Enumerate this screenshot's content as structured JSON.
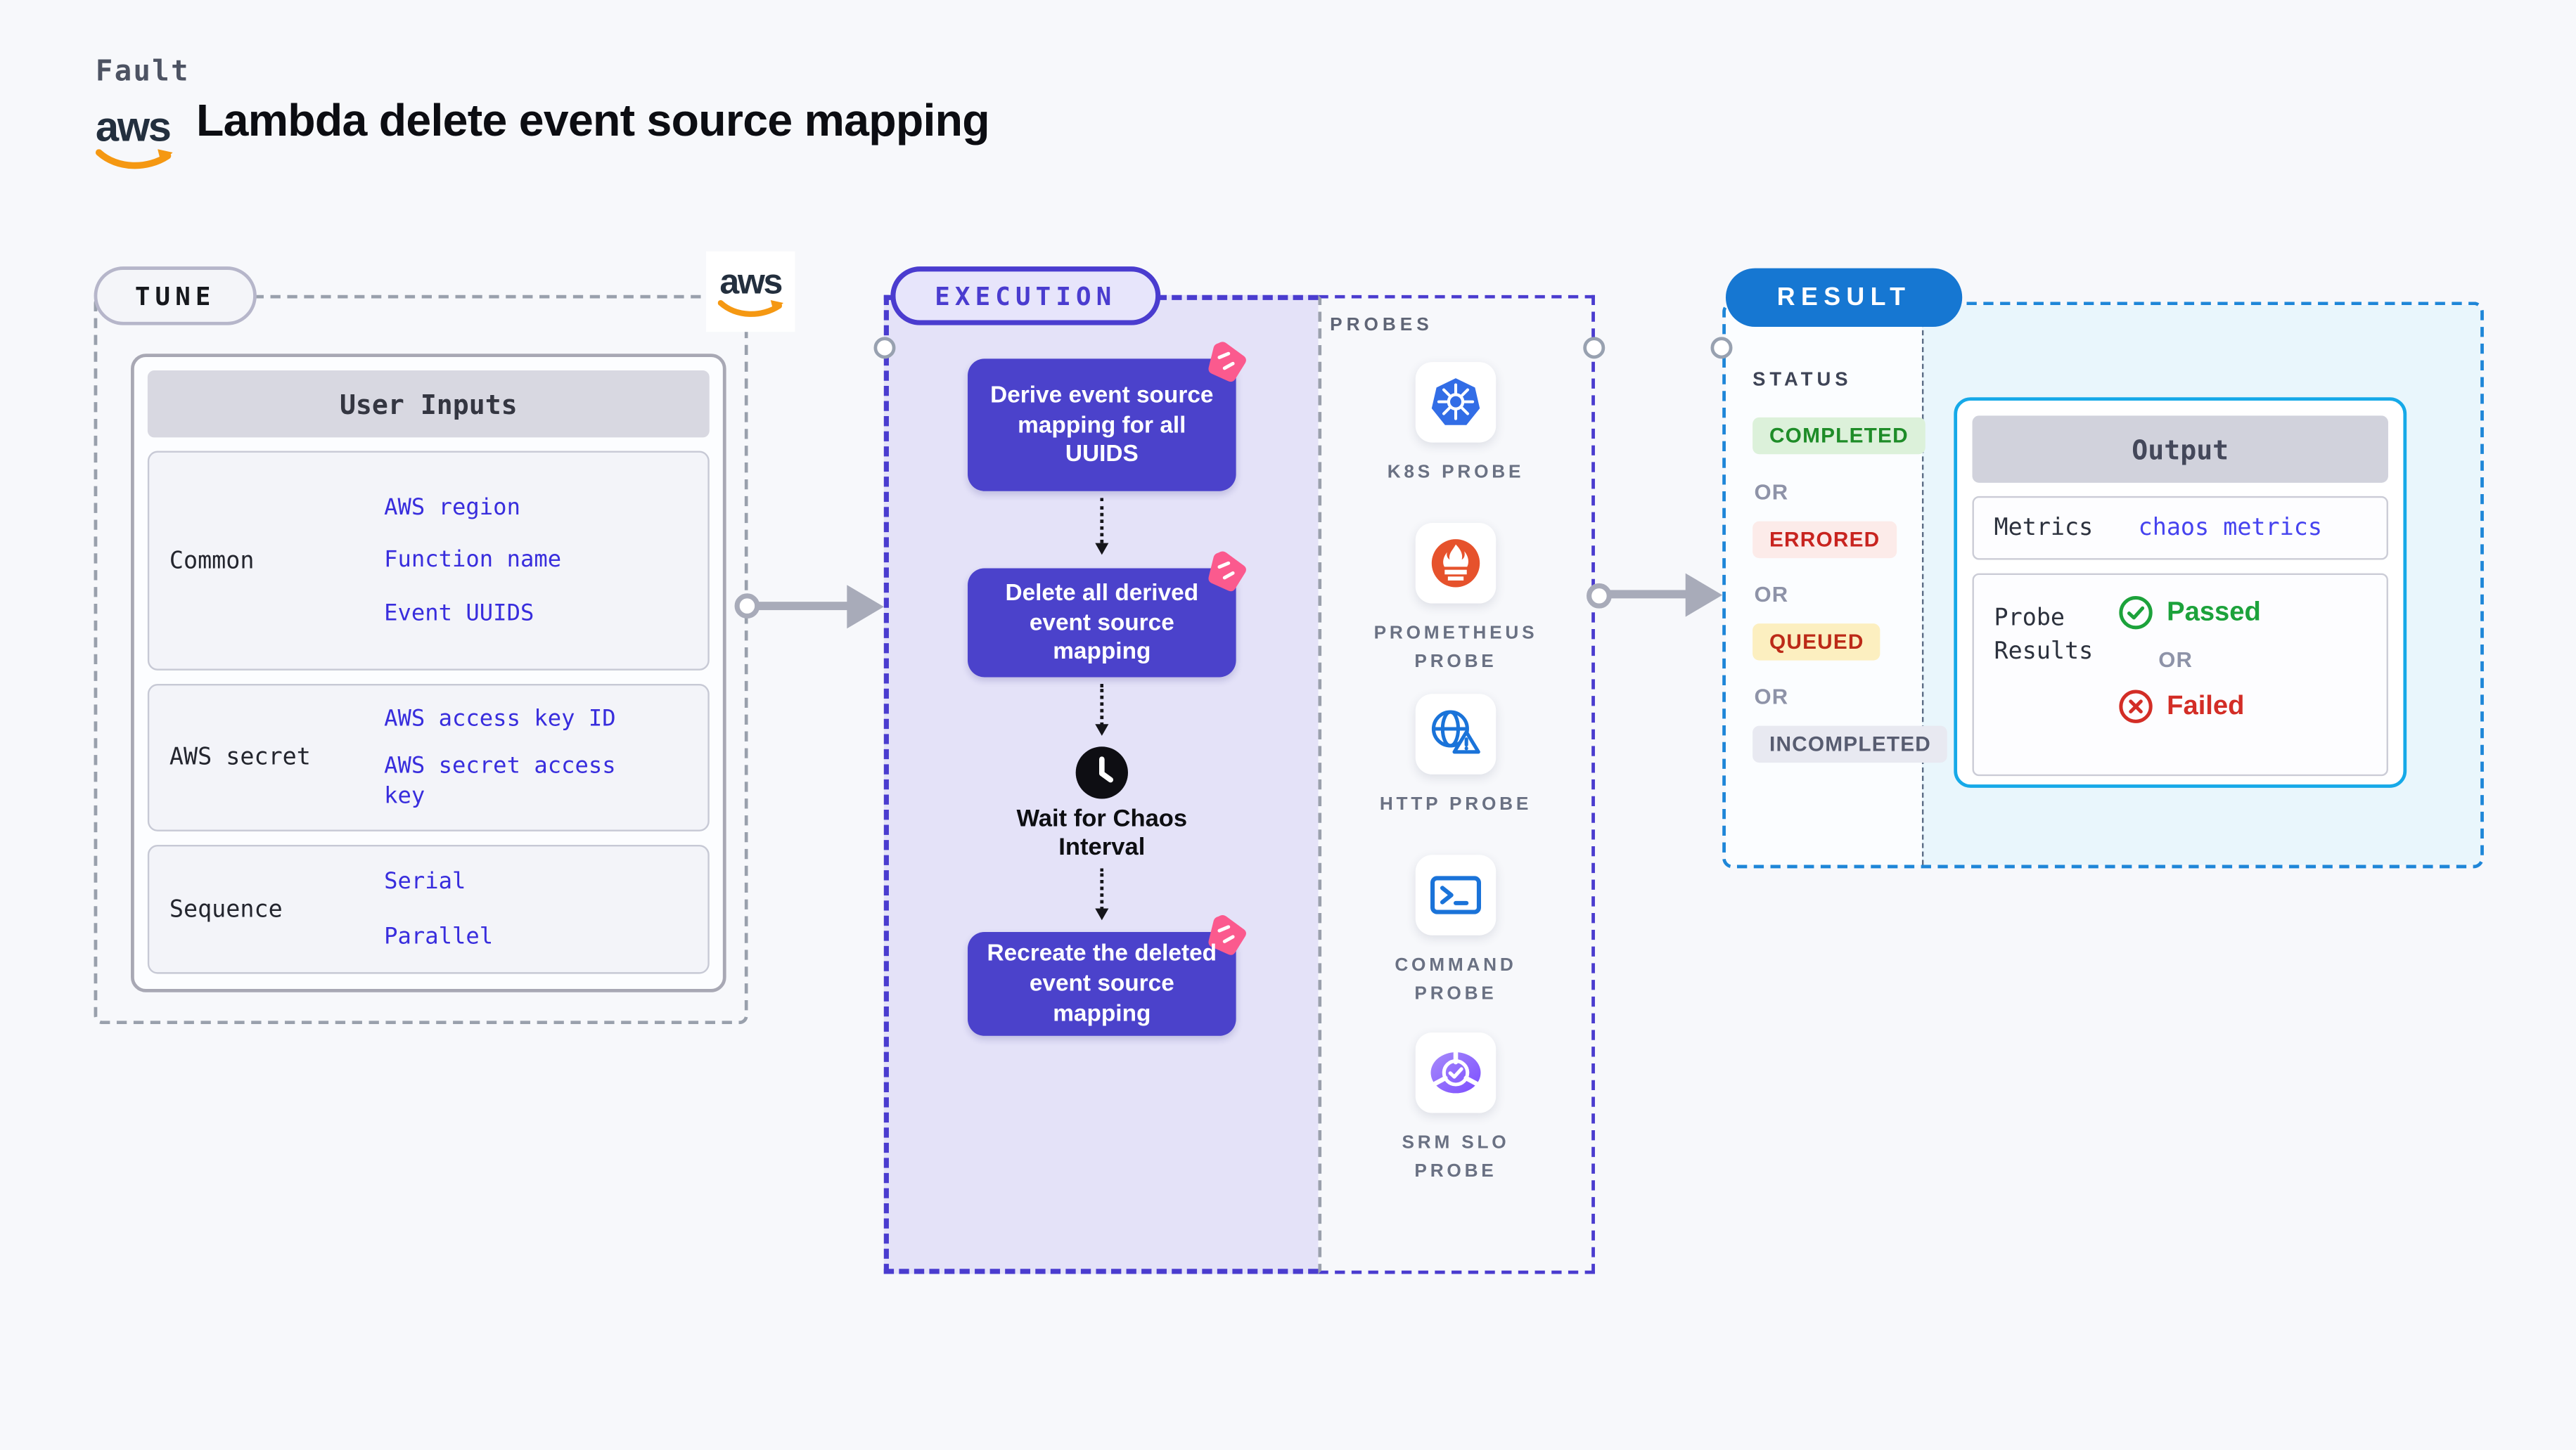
{
  "page": {
    "background": "#f7f8fb"
  },
  "header": {
    "kicker": "Fault",
    "title": "Lambda delete event source mapping",
    "aws_wordmark": "aws"
  },
  "tune": {
    "pill_label": "TUNE",
    "aws_wordmark": "aws",
    "user_inputs": {
      "header": "User Inputs",
      "rows": [
        {
          "label": "Common",
          "values": [
            "AWS region",
            "Function name",
            "Event UUIDS"
          ]
        },
        {
          "label": "AWS secret",
          "values": [
            "AWS access key ID",
            "AWS secret access key"
          ]
        },
        {
          "label": "Sequence",
          "values": [
            "Serial",
            "Parallel"
          ]
        }
      ]
    }
  },
  "execution": {
    "pill_label": "EXECUTION",
    "nodes": [
      {
        "label": "Derive event source mapping for all UUIDS",
        "icon": "chaos-step-icon"
      },
      {
        "label": "Delete all derived event source mapping",
        "icon": "chaos-step-icon"
      },
      {
        "label": "Recreate the deleted event source mapping",
        "icon": "chaos-step-icon"
      }
    ],
    "wait_step": {
      "label": "Wait for Chaos Interval",
      "icon": "clock-icon"
    }
  },
  "probes": {
    "heading": "PROBES",
    "items": [
      {
        "label": "K8S PROBE",
        "icon": "kubernetes-icon"
      },
      {
        "label": "PROMETHEUS PROBE",
        "icon": "prometheus-icon"
      },
      {
        "label": "HTTP PROBE",
        "icon": "http-globe-warning-icon"
      },
      {
        "label": "COMMAND PROBE",
        "icon": "terminal-icon"
      },
      {
        "label": "SRM SLO PROBE",
        "icon": "slo-donut-check-icon"
      }
    ]
  },
  "result": {
    "pill_label": "RESULT",
    "status": {
      "heading": "STATUS",
      "or_label": "OR",
      "badges": [
        {
          "label": "COMPLETED",
          "bg": "#dcf1da",
          "color": "#1e8c28"
        },
        {
          "label": "ERRORED",
          "bg": "#fcebe9",
          "color": "#c8241f"
        },
        {
          "label": "QUEUED",
          "bg": "#fcefc0",
          "color": "#bc2a18"
        },
        {
          "label": "INCOMPLETED",
          "bg": "#e8e9f1",
          "color": "#575c70"
        }
      ]
    },
    "output": {
      "header": "Output",
      "metrics_label": "Metrics",
      "metrics_link": "chaos metrics",
      "probe_results_label": "Probe Results",
      "passed_label": "Passed",
      "or_label": "OR",
      "failed_label": "Failed"
    }
  },
  "colors": {
    "accent_indigo": "#4a3ccf",
    "node_fill": "#4b42cb",
    "node_badge_pink": "#fb5a8e",
    "execution_bg": "#e4e2f8",
    "result_blue": "#1677d2",
    "result_dash_border": "#1e86d8",
    "output_card_border": "#16a9e8",
    "input_value_text": "#382ddd",
    "arrow_gray": "#a8abb9",
    "kubernetes_blue": "#326de6",
    "prometheus_orange": "#e6522c",
    "probe_icon_blue": "#1a73d9",
    "srm_purple": "#7c4dff",
    "aws_orange": "#f59812"
  }
}
